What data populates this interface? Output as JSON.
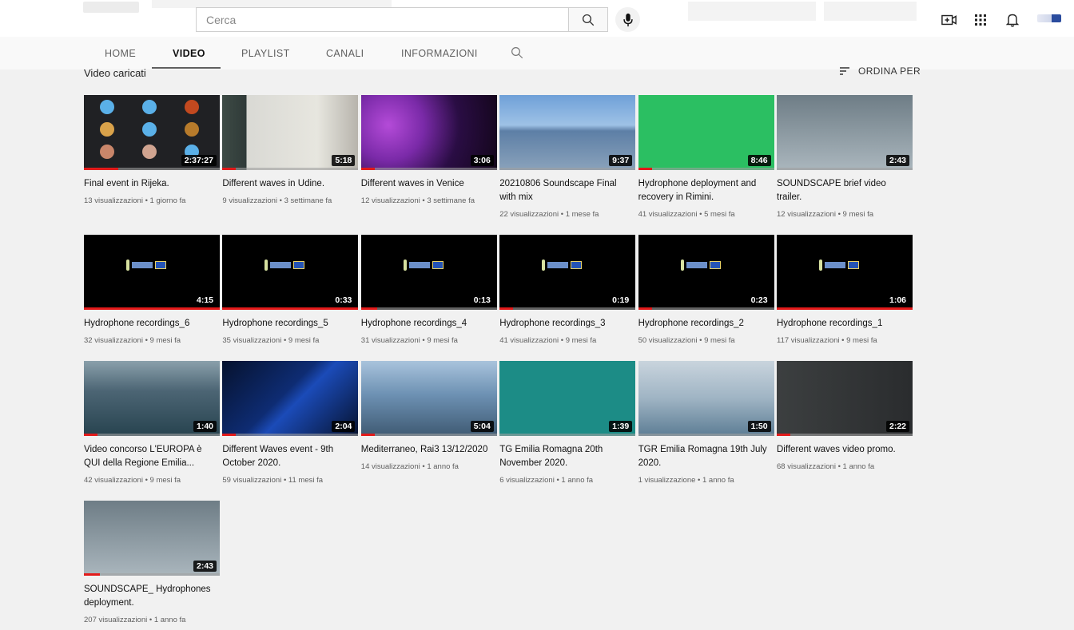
{
  "search": {
    "placeholder": "Cerca"
  },
  "tabs": [
    {
      "label": "HOME"
    },
    {
      "label": "VIDEO"
    },
    {
      "label": "PLAYLIST"
    },
    {
      "label": "CANALI"
    },
    {
      "label": "INFORMAZIONI"
    }
  ],
  "section": {
    "label": "Video caricati",
    "sort_label": "ORDINA PER"
  },
  "icons": {
    "search": "search-icon",
    "mic": "mic-icon",
    "create": "create-video-icon",
    "apps": "apps-grid-icon",
    "bell": "notifications-bell-icon",
    "sort": "sort-icon"
  },
  "colors": {
    "accent": "#e21a1a",
    "background": "#f1f1f1"
  },
  "videos": [
    {
      "title": "Final event in Rijeka.",
      "meta": "13 visualizzazioni • 1 giorno fa",
      "duration": "2:37:27",
      "progress": 0.25,
      "thumb": "t-meet"
    },
    {
      "title": "Different waves in Udine.",
      "meta": "9 visualizzazioni • 3 settimane fa",
      "duration": "5:18",
      "progress": 0.1,
      "thumb": "t-udine"
    },
    {
      "title": "Different waves in Venice",
      "meta": "12 visualizzazioni • 3 settimane fa",
      "duration": "3:06",
      "progress": 0.1,
      "thumb": "t-venice"
    },
    {
      "title": "20210806 Soundscape Final with mix",
      "meta": "22 visualizzazioni • 1 mese fa",
      "duration": "9:37",
      "progress": 0.0,
      "thumb": "t-lake"
    },
    {
      "title": "Hydrophone deployment and recovery in Rimini.",
      "meta": "41 visualizzazioni • 5 mesi fa",
      "duration": "8:46",
      "progress": 0.1,
      "thumb": "t-green"
    },
    {
      "title": "SOUNDSCAPE brief video trailer.",
      "meta": "12 visualizzazioni • 9 mesi fa",
      "duration": "2:43",
      "progress": 0.0,
      "thumb": "t-boat"
    },
    {
      "title": "Hydrophone recordings_6",
      "meta": "32 visualizzazioni • 9 mesi fa",
      "duration": "4:15",
      "progress": 1.0,
      "thumb": "t-black"
    },
    {
      "title": "Hydrophone recordings_5",
      "meta": "35 visualizzazioni • 9 mesi fa",
      "duration": "0:33",
      "progress": 1.0,
      "thumb": "t-black"
    },
    {
      "title": "Hydrophone recordings_4",
      "meta": "31 visualizzazioni • 9 mesi fa",
      "duration": "0:13",
      "progress": 0.12,
      "thumb": "t-black"
    },
    {
      "title": "Hydrophone recordings_3",
      "meta": "41 visualizzazioni • 9 mesi fa",
      "duration": "0:19",
      "progress": 0.1,
      "thumb": "t-black"
    },
    {
      "title": "Hydrophone recordings_2",
      "meta": "50 visualizzazioni • 9 mesi fa",
      "duration": "0:23",
      "progress": 0.1,
      "thumb": "t-black"
    },
    {
      "title": "Hydrophone recordings_1",
      "meta": "117 visualizzazioni • 9 mesi fa",
      "duration": "1:06",
      "progress": 1.0,
      "thumb": "t-black"
    },
    {
      "title": "Video concorso L'EUROPA è QUI della Regione Emilia...",
      "meta": "42 visualizzazioni • 9 mesi fa",
      "duration": "1:40",
      "progress": 0.1,
      "thumb": "t-sea1"
    },
    {
      "title": "Different Waves event - 9th October 2020.",
      "meta": "59 visualizzazioni • 11 mesi fa",
      "duration": "2:04",
      "progress": 0.1,
      "thumb": "t-wave"
    },
    {
      "title": "Mediterraneo, Rai3 13/12/2020",
      "meta": "14 visualizzazioni • 1 anno fa",
      "duration": "5:04",
      "progress": 0.1,
      "thumb": "t-med"
    },
    {
      "title": "TG Emilia Romagna 20th November 2020.",
      "meta": "6 visualizzazioni • 1 anno fa",
      "duration": "1:39",
      "progress": 0.0,
      "thumb": "t-teal"
    },
    {
      "title": "TGR Emilia Romagna 19th July 2020.",
      "meta": "1 visualizzazione • 1 anno fa",
      "duration": "1:50",
      "progress": 0.0,
      "thumb": "t-ship"
    },
    {
      "title": "Different waves video promo.",
      "meta": "68 visualizzazioni • 1 anno fa",
      "duration": "2:22",
      "progress": 0.1,
      "thumb": "t-man"
    },
    {
      "title": "SOUNDSCAPE_ Hydrophones deployment.",
      "meta": "207 visualizzazioni • 1 anno fa",
      "duration": "2:43",
      "progress": 0.12,
      "thumb": "t-boat"
    }
  ]
}
